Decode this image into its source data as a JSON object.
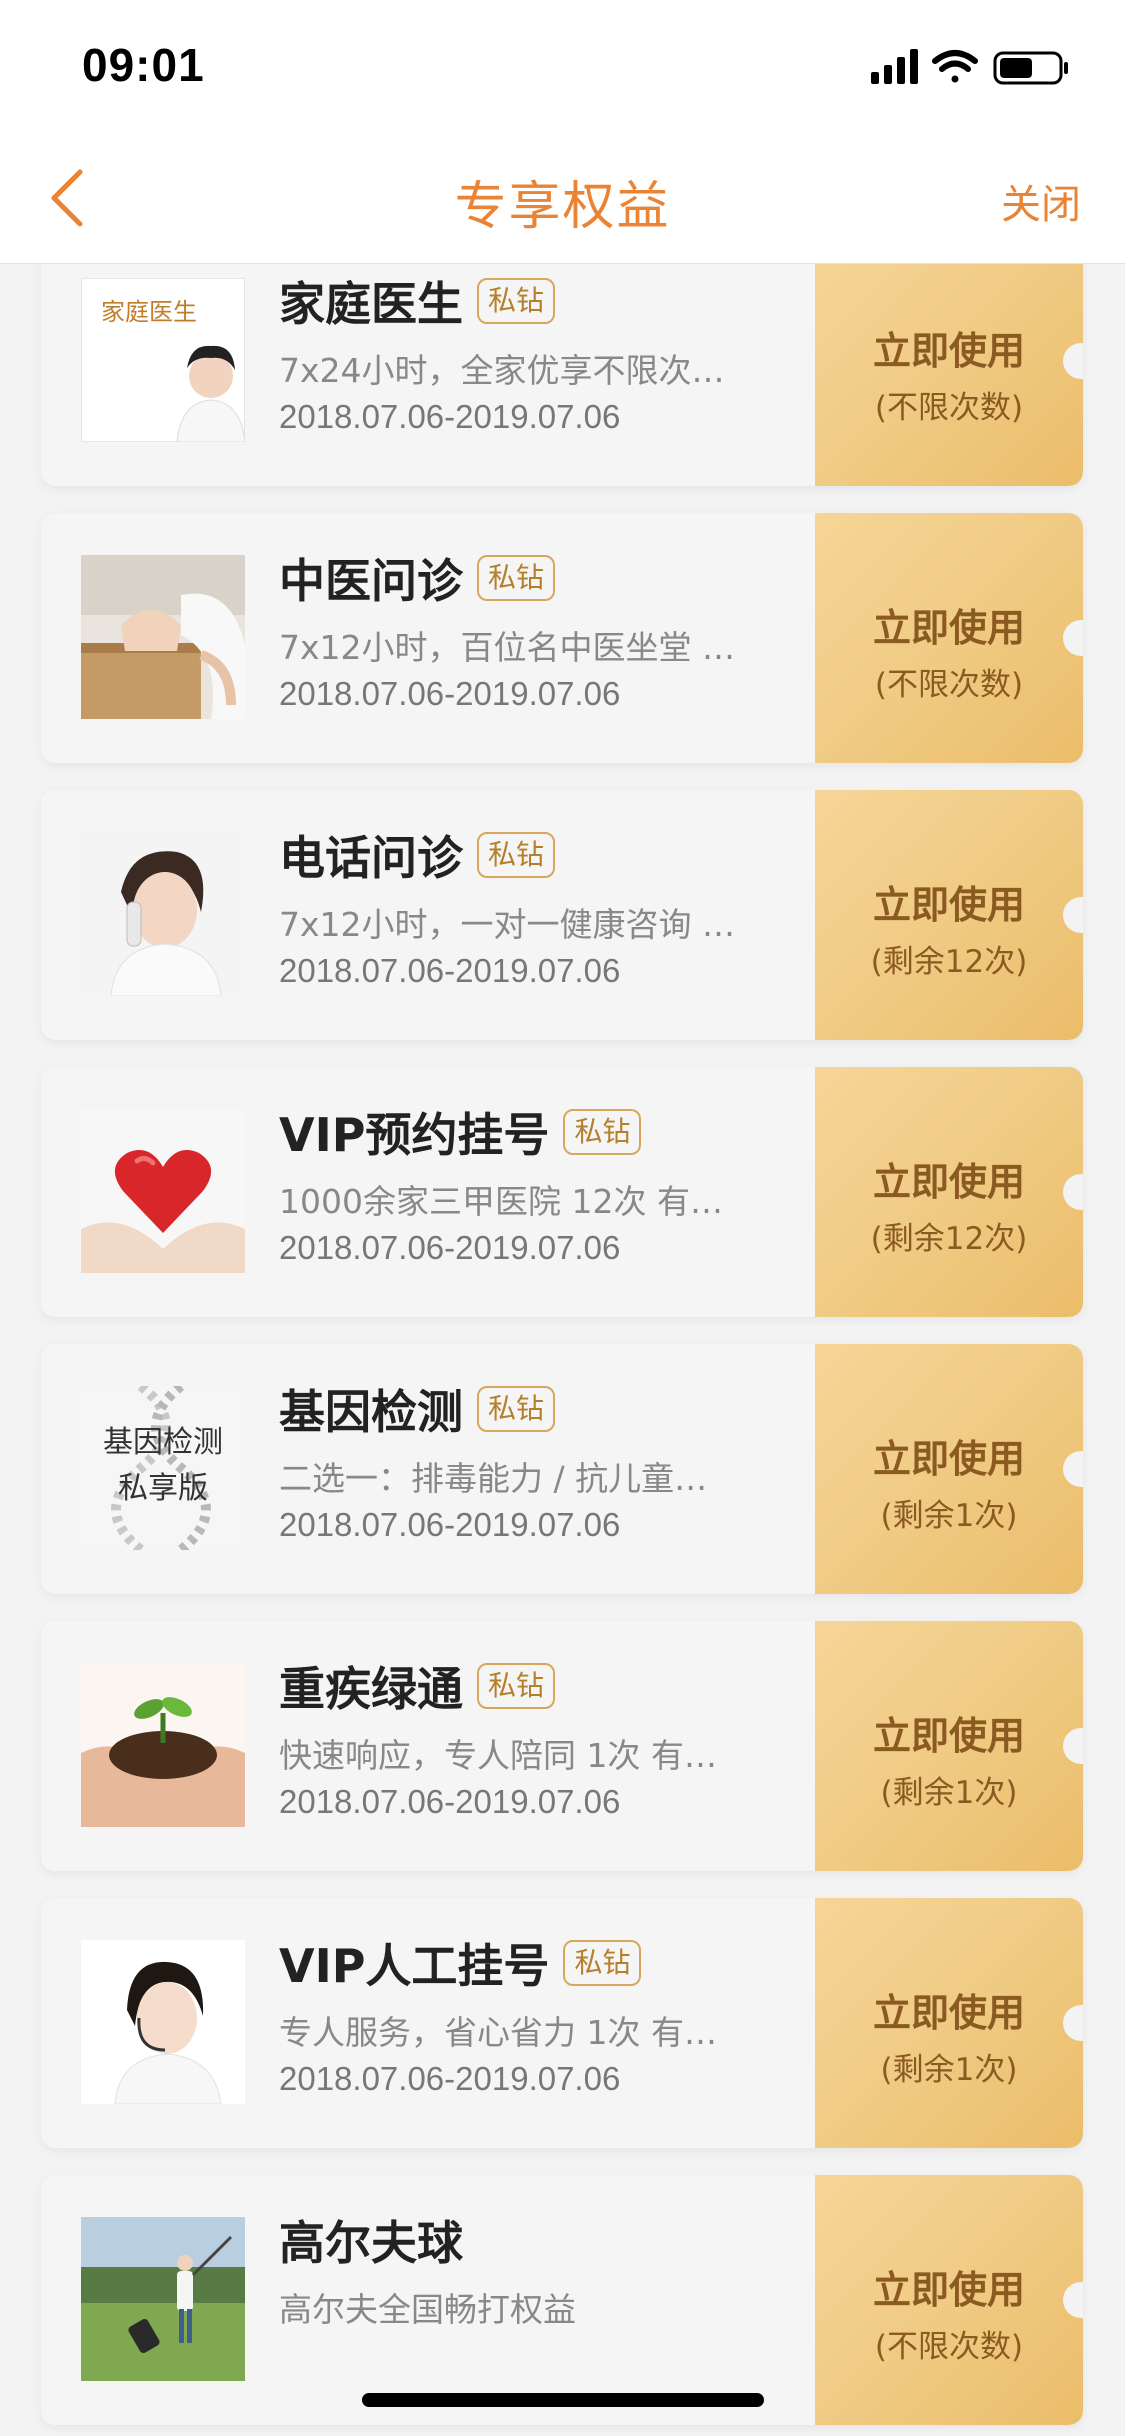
{
  "status": {
    "time": "09:01"
  },
  "nav": {
    "title": "专享权益",
    "close_label": "关闭"
  },
  "benefits": [
    {
      "title": "家庭医生",
      "badge": "私钻",
      "desc": "7x24小时，全家优享不限次…",
      "date": "2018.07.06-2019.07.06",
      "action": "立即使用",
      "count": "(不限次数)",
      "thumb_text": "家庭医生"
    },
    {
      "title": "中医问诊",
      "badge": "私钻",
      "desc": "7x12小时，百位名中医坐堂 …",
      "date": "2018.07.06-2019.07.06",
      "action": "立即使用",
      "count": "(不限次数)"
    },
    {
      "title": "电话问诊",
      "badge": "私钻",
      "desc": "7x12小时，一对一健康咨询 …",
      "date": "2018.07.06-2019.07.06",
      "action": "立即使用",
      "count": "(剩余12次)"
    },
    {
      "title": "VIP预约挂号",
      "badge": "私钻",
      "desc": "1000余家三甲医院 12次 有…",
      "date": "2018.07.06-2019.07.06",
      "action": "立即使用",
      "count": "(剩余12次)"
    },
    {
      "title": "基因检测",
      "badge": "私钻",
      "desc": "二选一：排毒能力 / 抗儿童…",
      "date": "2018.07.06-2019.07.06",
      "action": "立即使用",
      "count": "(剩余1次)",
      "thumb_text_1": "基因检测",
      "thumb_text_2": "私享版"
    },
    {
      "title": "重疾绿通",
      "badge": "私钻",
      "desc": "快速响应，专人陪同 1次 有…",
      "date": "2018.07.06-2019.07.06",
      "action": "立即使用",
      "count": "(剩余1次)"
    },
    {
      "title": "VIP人工挂号",
      "badge": "私钻",
      "desc": "专人服务，省心省力 1次 有…",
      "date": "2018.07.06-2019.07.06",
      "action": "立即使用",
      "count": "(剩余1次)"
    },
    {
      "title": "高尔夫球",
      "desc": "高尔夫全国畅打权益",
      "action": "立即使用",
      "count": "(不限次数)"
    }
  ],
  "colors": {
    "accent": "#ea8434",
    "gold": "#f0cc86",
    "gold_text": "#8a5a21",
    "badge_border": "#d7a75c"
  }
}
